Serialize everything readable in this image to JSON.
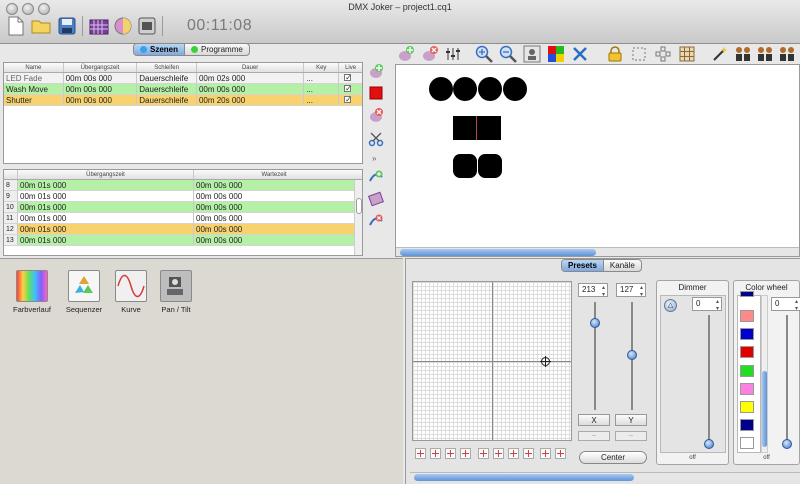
{
  "window": {
    "title": "DMX Joker – project1.cq1"
  },
  "toolbar": {
    "clock": "00:11:08"
  },
  "scene_tabs": [
    {
      "label": "Szenen",
      "color": "#3aa0e8"
    },
    {
      "label": "Programme",
      "color": "#3ad23a"
    }
  ],
  "scenes": {
    "columns": [
      "Name",
      "Übergangszeit",
      "Schleifen",
      "Dauer",
      "Key",
      "Live"
    ],
    "rows": [
      {
        "name": "LED Fade",
        "transition": "00m 00s 000",
        "loops": "Dauerschleife",
        "duration": "00m 02s 000",
        "key": "...",
        "live": true,
        "style": "plain"
      },
      {
        "name": "Wash Move",
        "transition": "00m 00s 000",
        "loops": "Dauerschleife",
        "duration": "00m 00s 000",
        "key": "...",
        "live": true,
        "style": "green"
      },
      {
        "name": "Shutter",
        "transition": "00m 00s 000",
        "loops": "Dauerschleife",
        "duration": "00m 20s 000",
        "key": "...",
        "live": true,
        "style": "yellow"
      }
    ]
  },
  "steps": {
    "columns": [
      "",
      "Übergangszeit",
      "Wartezeit"
    ],
    "rows": [
      {
        "n": "8",
        "transition": "00m 01s 000",
        "wait": "00m 00s 000",
        "style": "green"
      },
      {
        "n": "9",
        "transition": "00m 01s 000",
        "wait": "00m 00s 000",
        "style": "white"
      },
      {
        "n": "10",
        "transition": "00m 01s 000",
        "wait": "00m 00s 000",
        "style": "green"
      },
      {
        "n": "11",
        "transition": "00m 01s 000",
        "wait": "00m 00s 000",
        "style": "white"
      },
      {
        "n": "12",
        "transition": "00m 01s 000",
        "wait": "00m 00s 000",
        "style": "yellow"
      },
      {
        "n": "13",
        "transition": "00m 01s 000",
        "wait": "00m 00s 000",
        "style": "green"
      }
    ]
  },
  "effects": [
    {
      "label": "Farbverlauf",
      "icon": "rainbow-icon"
    },
    {
      "label": "Sequenzer",
      "icon": "recycle-icon"
    },
    {
      "label": "Kurve",
      "icon": "sine-curve-icon"
    },
    {
      "label": "Pan / Tilt",
      "icon": "pan-tilt-icon"
    }
  ],
  "control_tabs": [
    {
      "label": "Presets"
    },
    {
      "label": "Kanäle"
    }
  ],
  "pan_tilt": {
    "x_value": "213",
    "y_value": "127",
    "x_label": "X",
    "y_label": "Y",
    "center_label": "Center",
    "dash": "--"
  },
  "dimmer": {
    "title": "Dimmer",
    "value": "0",
    "off_label": "off"
  },
  "color_wheel": {
    "title": "Color wheel",
    "value": "0",
    "off_label": "off",
    "colors": [
      "#ffffff",
      "#ff8a8a",
      "#0000cc",
      "#e00000",
      "#22dd22",
      "#ff80e0",
      "#ffff00",
      "#000088",
      "#ffffff"
    ]
  }
}
